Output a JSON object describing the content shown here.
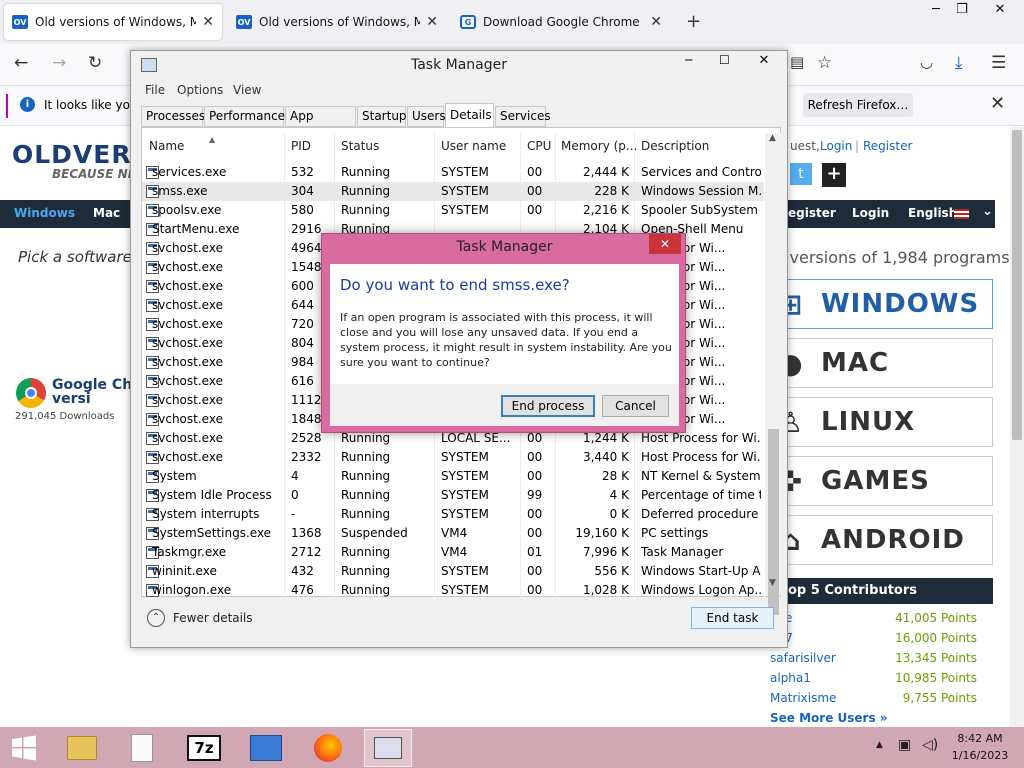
{
  "browser": {
    "tabs": [
      {
        "label": "Old versions of Windows, Mac a",
        "favicon": "OV",
        "active": true
      },
      {
        "label": "Old versions of Windows, Mac a",
        "favicon": "OV",
        "active": false
      },
      {
        "label": "Download Google Chrome by G",
        "favicon": "chrome-icon",
        "active": false
      }
    ],
    "new_tab": "+",
    "notification": "It looks like you",
    "refresh_button": "Refresh Firefox…"
  },
  "site": {
    "logo": "OLDVER",
    "slogan": "BECAUSE NEW",
    "auth": {
      "prefix": "uest,",
      "login": "Login",
      "register": "Register"
    },
    "nav": {
      "windows": "Windows",
      "mac": "Mac",
      "register": "egister",
      "login": "Login",
      "lang": "English"
    },
    "pick": "Pick a software",
    "featured": {
      "title1": "Google Chr",
      "title2": "versi",
      "downloads": "291,045 Downloads"
    },
    "versions_text": "l versions of 1,984 programs",
    "platforms": [
      "Windows",
      "Mac",
      "Linux",
      "Games",
      "Android"
    ],
    "top_contrib_title": "op 5 Contributors",
    "contributors": [
      {
        "name": "ane",
        "points": "41,005 Points"
      },
      {
        "name": "017",
        "points": "16,000 Points"
      },
      {
        "name": "safarisilver",
        "points": "13,345 Points"
      },
      {
        "name": "alpha1",
        "points": "10,985 Points"
      },
      {
        "name": "Matrixisme",
        "points": "9,755 Points"
      }
    ],
    "see_more": "See More Users »"
  },
  "taskmanager": {
    "title": "Task Manager",
    "menu": [
      "File",
      "Options",
      "View"
    ],
    "tabs": [
      "Processes",
      "Performance",
      "App history",
      "Startup",
      "Users",
      "Details",
      "Services"
    ],
    "active_tab": "Details",
    "columns": [
      "Name",
      "PID",
      "Status",
      "User name",
      "CPU",
      "Memory (p...",
      "Description"
    ],
    "rows": [
      [
        "services.exe",
        "532",
        "Running",
        "SYSTEM",
        "00",
        "2,444 K",
        "Services and Control..."
      ],
      [
        "smss.exe",
        "304",
        "Running",
        "SYSTEM",
        "00",
        "228 K",
        "Windows Session M..."
      ],
      [
        "spoolsv.exe",
        "580",
        "Running",
        "SYSTEM",
        "00",
        "2,216 K",
        "Spooler SubSystem ..."
      ],
      [
        "StartMenu.exe",
        "2916",
        "Running",
        "",
        "",
        "2,104 K",
        "Open-Shell Menu"
      ],
      [
        "svchost.exe",
        "4964",
        "",
        "",
        "",
        "",
        "ocess for Wi..."
      ],
      [
        "svchost.exe",
        "1548",
        "",
        "",
        "",
        "",
        "ocess for Wi..."
      ],
      [
        "svchost.exe",
        "600",
        "",
        "",
        "",
        "",
        "ocess for Wi..."
      ],
      [
        "svchost.exe",
        "644",
        "",
        "",
        "",
        "",
        "ocess for Wi..."
      ],
      [
        "svchost.exe",
        "720",
        "",
        "",
        "",
        "",
        "ocess for Wi..."
      ],
      [
        "svchost.exe",
        "804",
        "",
        "",
        "",
        "",
        "ocess for Wi..."
      ],
      [
        "svchost.exe",
        "984",
        "",
        "",
        "",
        "",
        "ocess for Wi..."
      ],
      [
        "svchost.exe",
        "616",
        "",
        "",
        "",
        "",
        "ocess for Wi..."
      ],
      [
        "svchost.exe",
        "1112",
        "",
        "",
        "",
        "",
        "ocess for Wi..."
      ],
      [
        "svchost.exe",
        "1848",
        "",
        "",
        "",
        "",
        "ocess for Wi..."
      ],
      [
        "svchost.exe",
        "2528",
        "Running",
        "LOCAL SE...",
        "00",
        "1,244 K",
        "Host Process for Wi..."
      ],
      [
        "svchost.exe",
        "2332",
        "Running",
        "SYSTEM",
        "00",
        "3,440 K",
        "Host Process for Wi..."
      ],
      [
        "System",
        "4",
        "Running",
        "SYSTEM",
        "00",
        "28 K",
        "NT Kernel & System"
      ],
      [
        "System Idle Process",
        "0",
        "Running",
        "SYSTEM",
        "99",
        "4 K",
        "Percentage of time t..."
      ],
      [
        "System interrupts",
        "-",
        "Running",
        "SYSTEM",
        "00",
        "0 K",
        "Deferred procedure ..."
      ],
      [
        "SystemSettings.exe",
        "1368",
        "Suspended",
        "VM4",
        "00",
        "19,160 K",
        "PC settings"
      ],
      [
        "Taskmgr.exe",
        "2712",
        "Running",
        "VM4",
        "01",
        "7,996 K",
        "Task Manager"
      ],
      [
        "wininit.exe",
        "432",
        "Running",
        "SYSTEM",
        "00",
        "556 K",
        "Windows Start-Up A..."
      ],
      [
        "winlogon.exe",
        "476",
        "Running",
        "SYSTEM",
        "00",
        "1,028 K",
        "Windows Logon Ap..."
      ]
    ],
    "fewer_details": "Fewer details",
    "end_task": "End task"
  },
  "dialog": {
    "title": "Task Manager",
    "heading": "Do you want to end smss.exe?",
    "message": "If an open program is associated with this process, it will close and you will lose any unsaved data. If you end a system process, it might result in system instability. Are you sure you want to continue?",
    "end_process": "End process",
    "cancel": "Cancel"
  },
  "taskbar": {
    "time": "8:42 AM",
    "date": "1/16/2023"
  }
}
